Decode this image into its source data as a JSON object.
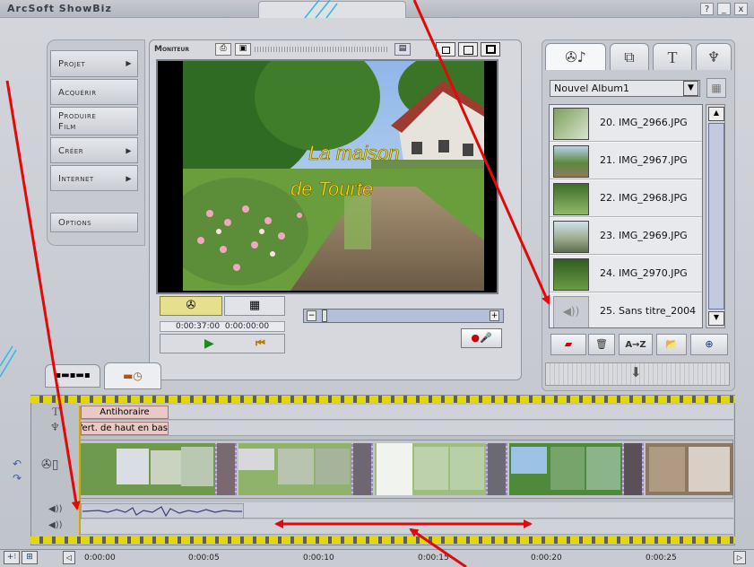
{
  "app": {
    "title": "ArcSoft ShowBiz",
    "help_btn": "?",
    "min_btn": "_",
    "close_btn": "x"
  },
  "nav": {
    "items": [
      {
        "label": "Projet",
        "has_arrow": true
      },
      {
        "label": "Acquérir",
        "has_arrow": false
      },
      {
        "label": "Produire Film",
        "has_arrow": false
      },
      {
        "label": "Créer",
        "has_arrow": true
      },
      {
        "label": "Internet",
        "has_arrow": true
      }
    ],
    "options": "Options"
  },
  "monitor": {
    "label": "Moniteur",
    "overlay_line1": "La maison",
    "overlay_line2": "de Tourte",
    "timecode_current": "0:00:37:00",
    "timecode_total": "0:00:00:00"
  },
  "album": {
    "selected": "Nouvel Album1",
    "items": [
      {
        "label": "20. IMG_2966.JPG"
      },
      {
        "label": "21. IMG_2967.JPG"
      },
      {
        "label": "22. IMG_2968.JPG"
      },
      {
        "label": "23. IMG_2969.JPG"
      },
      {
        "label": "24. IMG_2970.JPG"
      },
      {
        "label": "25. Sans titre_2004"
      }
    ]
  },
  "toolbar": {
    "sort_label": "A→Z"
  },
  "timeline": {
    "text_clip": "Antihoraire",
    "transition_clip": "Vert. de haut en bas",
    "ticks": [
      "0:00:00",
      "0:00:05",
      "0:00:10",
      "0:00:15",
      "0:00:20",
      "0:00:25"
    ]
  },
  "colors": {
    "annotation": "#e00a0a",
    "track_stripe": "#e3d70a",
    "transition_frame": "#a37dd8"
  }
}
